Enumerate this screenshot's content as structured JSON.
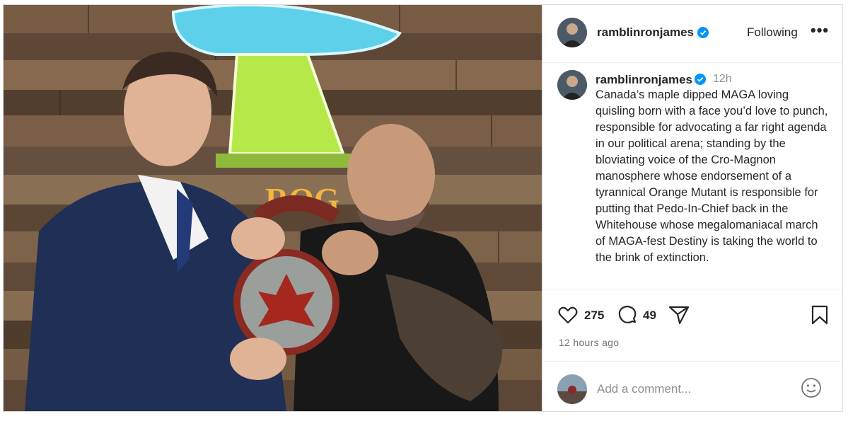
{
  "post": {
    "username": "ramblinronjames",
    "follow_label": "Following",
    "more_label": "•••",
    "time_ago": "12h",
    "caption": "Canada’s maple dipped MAGA loving quisling born with a face you’d love to punch, responsible for advocating a far right agenda in our political arena; standing by the bloviating voice of the Cro-Magnon manosphere whose endorsement of a tyrannical Orange Mutant is responsible for putting that Pedo-In-Chief back in the Whitehouse whose megalomaniacal march of MAGA-fest Destiny is taking the world to the brink of extinction.",
    "likes": "275",
    "comments": "49",
    "posted": "12 hours ago"
  },
  "comment_box": {
    "placeholder": "Add a comment..."
  },
  "icons": {
    "verified": "verified-badge-icon",
    "like": "heart-icon",
    "comment": "comment-bubble-icon",
    "share": "paper-plane-icon",
    "save": "bookmark-icon",
    "emoji": "smiley-icon"
  },
  "colors": {
    "verified_blue": "#0095f6",
    "text": "#262626",
    "secondary": "#8e8e8e"
  }
}
